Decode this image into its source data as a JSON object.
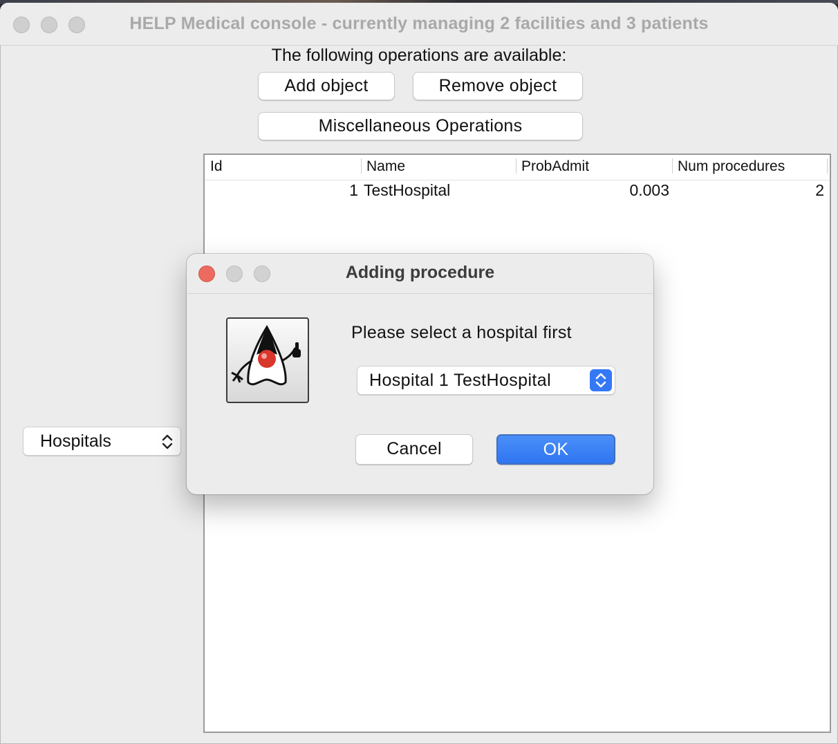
{
  "main_window": {
    "title": "HELP Medical console - currently managing 2 facilities and 3 patients",
    "operations_label": "The following operations are available:",
    "buttons": {
      "add_object": "Add object",
      "remove_object": "Remove object",
      "misc_operations": "Miscellaneous Operations"
    },
    "object_type_select": {
      "selected": "Hospitals"
    },
    "table": {
      "columns": [
        "Id",
        "Name",
        "ProbAdmit",
        "Num procedures"
      ],
      "rows": [
        {
          "id": "1",
          "name": "TestHospital",
          "prob_admit": "0.003",
          "num_procedures": "2"
        }
      ]
    }
  },
  "dialog": {
    "title": "Adding procedure",
    "prompt": "Please select a hospital first",
    "hospital_select": {
      "selected": "Hospital 1 TestHospital"
    },
    "buttons": {
      "cancel": "Cancel",
      "ok": "OK"
    },
    "icon": "java-duke-icon"
  },
  "colors": {
    "accent_blue": "#3478f6",
    "close_red": "#ec6a5e",
    "window_bg": "#ececec"
  }
}
